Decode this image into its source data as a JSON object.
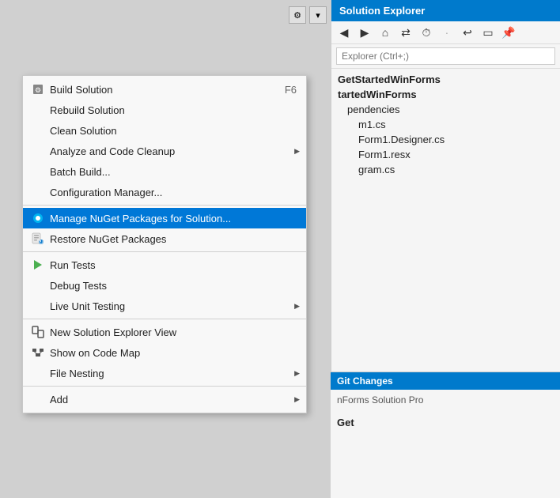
{
  "solution_explorer": {
    "title": "Solution Explorer",
    "search_placeholder": "Explorer (Ctrl+;)",
    "tree_items": [
      {
        "label": "GetStartedWinForms",
        "level": 0
      },
      {
        "label": "tartedWinForms",
        "level": 0
      },
      {
        "label": "pendencies",
        "level": 1
      },
      {
        "label": "m1.cs",
        "level": 2
      },
      {
        "label": "Form1.Designer.cs",
        "level": 2
      },
      {
        "label": "Form1.resx",
        "level": 2
      },
      {
        "label": "gram.cs",
        "level": 2
      }
    ],
    "bottom_text": "Get"
  },
  "git_changes": {
    "title": "Git Changes"
  },
  "context_menu": {
    "items": [
      {
        "id": "build-solution",
        "icon": "⚙",
        "label": "Build Solution",
        "shortcut": "F6",
        "has_submenu": false,
        "highlighted": false,
        "separator_after": false
      },
      {
        "id": "rebuild-solution",
        "icon": "",
        "label": "Rebuild Solution",
        "shortcut": "",
        "has_submenu": false,
        "highlighted": false,
        "separator_after": false
      },
      {
        "id": "clean-solution",
        "icon": "",
        "label": "Clean Solution",
        "shortcut": "",
        "has_submenu": false,
        "highlighted": false,
        "separator_after": false
      },
      {
        "id": "analyze-code",
        "icon": "",
        "label": "Analyze and Code Cleanup",
        "shortcut": "",
        "has_submenu": true,
        "highlighted": false,
        "separator_after": false
      },
      {
        "id": "batch-build",
        "icon": "",
        "label": "Batch Build...",
        "shortcut": "",
        "has_submenu": false,
        "highlighted": false,
        "separator_after": false
      },
      {
        "id": "configuration-manager",
        "icon": "",
        "label": "Configuration Manager...",
        "shortcut": "",
        "has_submenu": false,
        "highlighted": false,
        "separator_after": true
      },
      {
        "id": "manage-nuget",
        "icon": "🔵",
        "label": "Manage NuGet Packages for Solution...",
        "shortcut": "",
        "has_submenu": false,
        "highlighted": true,
        "separator_after": false
      },
      {
        "id": "restore-nuget",
        "icon": "📦",
        "label": "Restore NuGet Packages",
        "shortcut": "",
        "has_submenu": false,
        "highlighted": false,
        "separator_after": true
      },
      {
        "id": "run-tests",
        "icon": "🧪",
        "label": "Run Tests",
        "shortcut": "",
        "has_submenu": false,
        "highlighted": false,
        "separator_after": false
      },
      {
        "id": "debug-tests",
        "icon": "",
        "label": "Debug Tests",
        "shortcut": "",
        "has_submenu": false,
        "highlighted": false,
        "separator_after": false
      },
      {
        "id": "live-unit-testing",
        "icon": "",
        "label": "Live Unit Testing",
        "shortcut": "",
        "has_submenu": true,
        "highlighted": false,
        "separator_after": true
      },
      {
        "id": "new-solution-explorer-view",
        "icon": "🗂",
        "label": "New Solution Explorer View",
        "shortcut": "",
        "has_submenu": false,
        "highlighted": false,
        "separator_after": false
      },
      {
        "id": "show-on-code-map",
        "icon": "🗺",
        "label": "Show on Code Map",
        "shortcut": "",
        "has_submenu": false,
        "highlighted": false,
        "separator_after": false
      },
      {
        "id": "file-nesting",
        "icon": "",
        "label": "File Nesting",
        "shortcut": "",
        "has_submenu": true,
        "highlighted": false,
        "separator_after": true
      },
      {
        "id": "add",
        "icon": "",
        "label": "Add",
        "shortcut": "",
        "has_submenu": true,
        "highlighted": false,
        "separator_after": false
      }
    ]
  },
  "toolbar": {
    "settings_icon": "⚙",
    "arrow_icon": "▾"
  }
}
